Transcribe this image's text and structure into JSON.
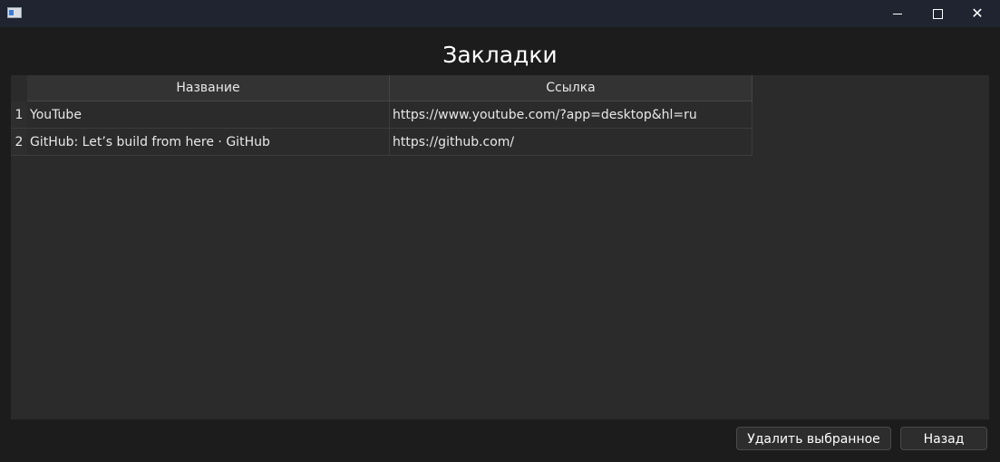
{
  "window": {
    "icon": "app-window-icon",
    "controls": {
      "minimize": "minimize-icon",
      "maximize": "maximize-icon",
      "close": "close-icon"
    }
  },
  "heading": "Закладки",
  "table": {
    "columns": [
      "Название",
      "Ссылка"
    ],
    "rows": [
      {
        "num": "1",
        "name": "YouTube",
        "link": "https://www.youtube.com/?app=desktop&hl=ru"
      },
      {
        "num": "2",
        "name": "GitHub: Let’s build from here · GitHub",
        "link": "https://github.com/"
      }
    ]
  },
  "buttons": {
    "delete_label": "Удалить выбранное",
    "back_label": "Назад"
  },
  "colors": {
    "background": "#1c1c1c",
    "titlebar": "#1f2430",
    "table_bg": "#2b2b2b",
    "text": "#e8e8e8"
  }
}
